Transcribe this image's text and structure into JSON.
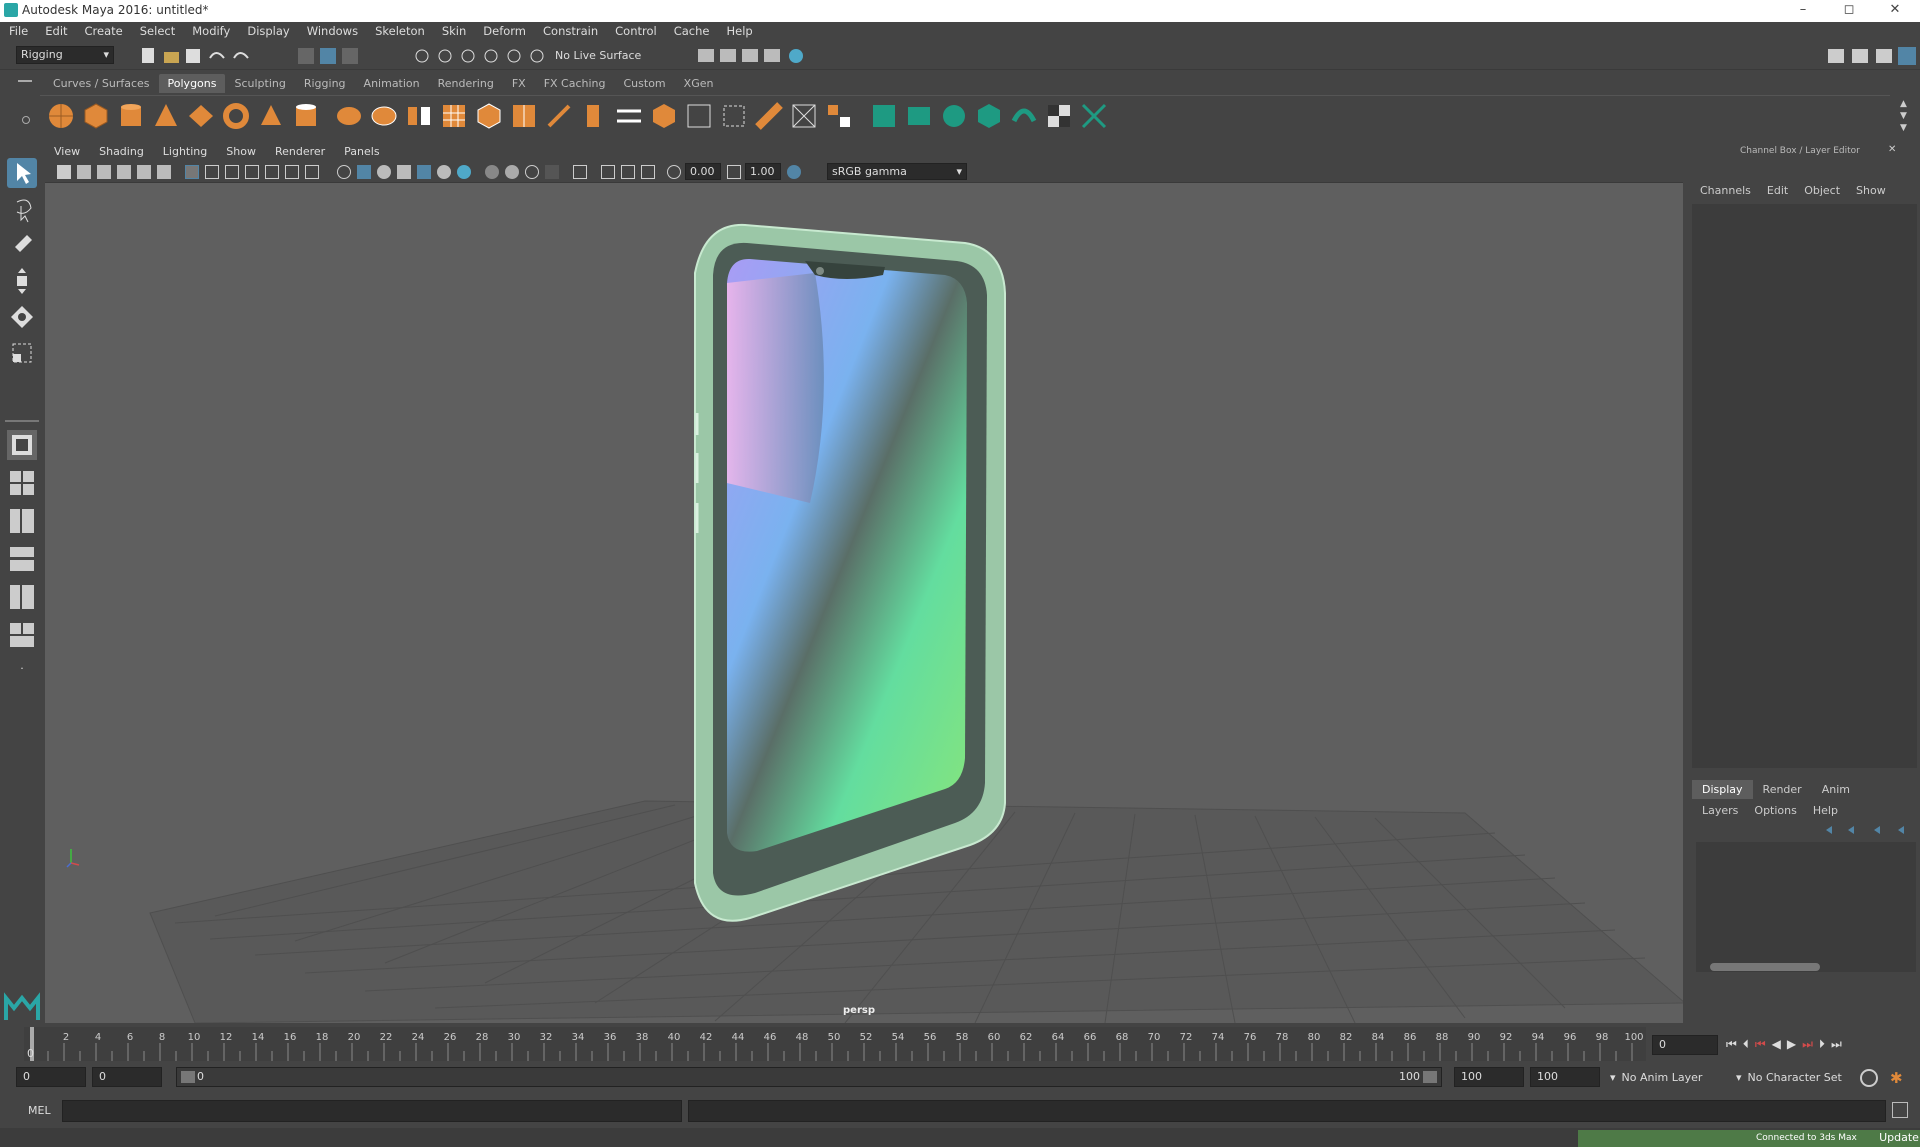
{
  "window": {
    "title": "Autodesk Maya 2016: untitled*",
    "minimize": "–",
    "maximize": "◻",
    "close": "✕"
  },
  "menu": [
    "File",
    "Edit",
    "Create",
    "Select",
    "Modify",
    "Display",
    "Windows",
    "Skeleton",
    "Skin",
    "Deform",
    "Constrain",
    "Control",
    "Cache",
    "Help"
  ],
  "status_line": {
    "mode": "Rigging",
    "live_surface": "No Live Surface"
  },
  "shelf_tabs": [
    "Curves / Surfaces",
    "Polygons",
    "Sculpting",
    "Rigging",
    "Animation",
    "Rendering",
    "FX",
    "FX Caching",
    "Custom",
    "XGen"
  ],
  "shelf_active": "Polygons",
  "viewport": {
    "menu": [
      "View",
      "Shading",
      "Lighting",
      "Show",
      "Renderer",
      "Panels"
    ],
    "exposure": "0.00",
    "gamma": "1.00",
    "color_space": "sRGB gamma",
    "camera_label": "persp"
  },
  "channel_box": {
    "title": "Channel Box / Layer Editor",
    "menu": [
      "Channels",
      "Edit",
      "Object",
      "Show"
    ]
  },
  "layer_editor": {
    "tabs": [
      "Display",
      "Render",
      "Anim"
    ],
    "active_tab": "Display",
    "menu": [
      "Layers",
      "Options",
      "Help"
    ]
  },
  "timeline": {
    "ticks": [
      "2",
      "4",
      "6",
      "8",
      "10",
      "12",
      "14",
      "16",
      "18",
      "20",
      "22",
      "24",
      "26",
      "28",
      "30",
      "32",
      "34",
      "36",
      "38",
      "40",
      "42",
      "44",
      "46",
      "48",
      "50",
      "52",
      "54",
      "56",
      "58",
      "60",
      "62",
      "64",
      "66",
      "68",
      "70",
      "72",
      "74",
      "76",
      "78",
      "80",
      "82",
      "84",
      "86",
      "88",
      "90",
      "92",
      "94",
      "96",
      "98",
      "100"
    ],
    "start_label": "0",
    "current_frame": "0"
  },
  "range": {
    "start_time": "0",
    "playback_start": "0",
    "slider_start": "0",
    "slider_end": "100",
    "playback_end": "100",
    "end_time": "100",
    "anim_layer": "No Anim Layer",
    "char_set": "No Character Set"
  },
  "command": {
    "lang": "MEL"
  },
  "help_line": {
    "connection": "Connected to 3ds Max",
    "update": "Update"
  },
  "colors": {
    "accent": "#5285a6",
    "phone_body": "#a9d3b5",
    "ground_grid": "#4f4f4f",
    "help_green": "#4e7a47"
  }
}
